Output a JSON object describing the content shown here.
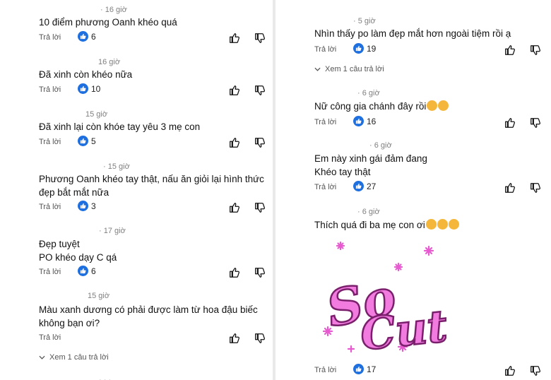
{
  "comments_left": [
    {
      "time": "· 16 giờ",
      "text": "10 điểm phương Oanh khéo quá",
      "reply": "Trả lời",
      "likes": "6"
    },
    {
      "time": "16 giờ",
      "text": "Đã xinh còn khéo nữa",
      "reply": "Trả lời",
      "likes": "10"
    },
    {
      "time": "15 giờ",
      "text": "Đã xinh lại còn khóe tay yêu 3 mẹ con",
      "reply": "Trả lời",
      "likes": "5"
    },
    {
      "time": "· 15 giờ",
      "text": "Phương Oanh khéo tay thật, nấu ăn giỏi lại hình thức đẹp bắt mắt nữa",
      "reply": "Trả lời",
      "likes": "3"
    },
    {
      "time": "· 17 giờ",
      "text": "Đẹp tuyệt\nPO khéo dạy C qá",
      "reply": "Trả lời",
      "likes": "6"
    },
    {
      "time": "15 giờ",
      "text": "Màu xanh dương có phải được làm từ hoa đậu biếc không bạn ơi?",
      "reply": "Trả lời",
      "likes": ""
    }
  ],
  "view_replies_left": "Xem 1 câu trả lời",
  "comments_right": [
    {
      "time": "· 5 giờ",
      "text": "Nhìn thấy po làm đẹp mắt hơn ngoài tiệm rồi ạ",
      "reply": "Trả lời",
      "likes": "19"
    },
    {
      "time": "· 6 giờ",
      "text": "Nữ công gia chánh đây rồi",
      "reply": "Trả lời",
      "likes": "16"
    },
    {
      "time": "· 6 giờ",
      "text": "Em này xinh gái đảm đang\nKhéo tay thật",
      "reply": "Trả lời",
      "likes": "27"
    },
    {
      "time": "· 6 giờ",
      "text": "Thích quá đi ba mẹ con ơi",
      "reply": "Trả lời",
      "likes": "17"
    }
  ],
  "view_replies_right": "Xem 1 câu trả lời",
  "sticker_text": "So Cute",
  "colors": {
    "like_blue": "#1e6fe0",
    "sticker_pink": "#e85ad0",
    "meta_gray": "#808080"
  },
  "icons": [
    "thumbs-up-icon",
    "thumbs-down-icon",
    "like-badge-icon",
    "chevron-down-icon",
    "smiling-face-with-hearts-emoji"
  ]
}
